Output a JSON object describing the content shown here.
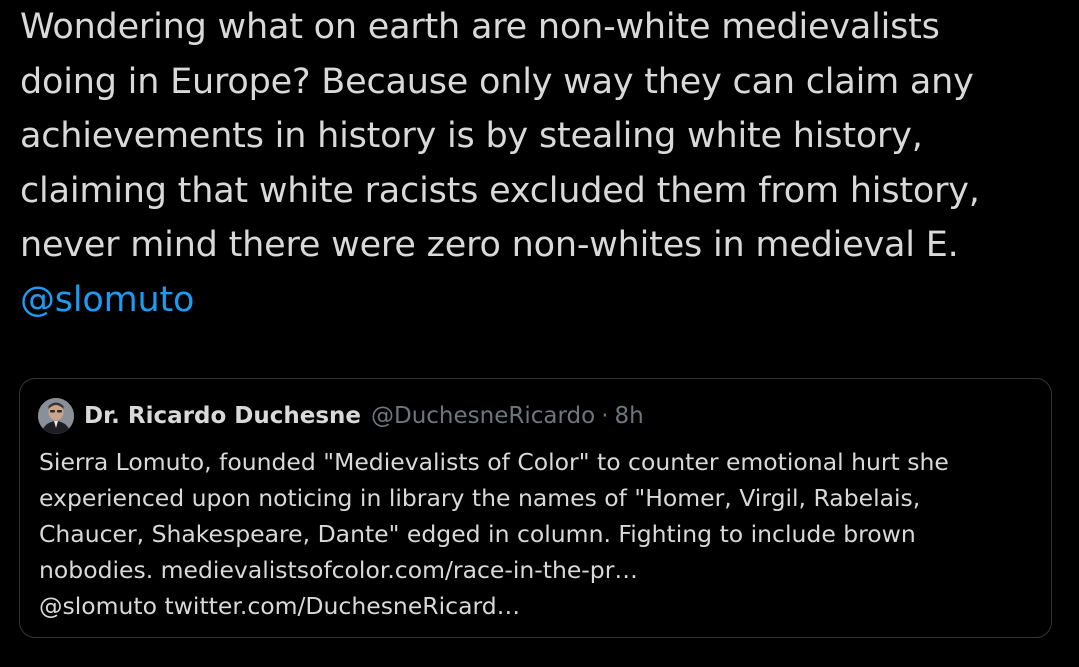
{
  "tweet": {
    "lines": [
      "Wondering what on earth are non-white medievalists",
      "doing in Europe? Because only way they can claim any",
      "achievements in history is by stealing white history,",
      "claiming that white racists excluded them from history,",
      "never mind there were zero non-whites in medieval E."
    ],
    "mention": "@slomuto"
  },
  "quote": {
    "author_name": "Dr. Ricardo Duchesne",
    "author_handle": "@DuchesneRicardo",
    "separator": "·",
    "time": "8h",
    "lines": [
      "Sierra Lomuto, founded \"Medievalists of Color\" to counter emotional hurt she",
      "experienced upon noticing in library the names of \"Homer, Virgil, Rabelais,",
      "Chaucer, Shakespeare, Dante\" edged in column. Fighting to include brown",
      "nobodies. medievalistsofcolor.com/race-in-the-pr…",
      "@slomuto twitter.com/DuchesneRicard…"
    ]
  },
  "colors": {
    "background": "#000000",
    "text": "#d9d9d9",
    "link": "#1d9bf0",
    "muted": "#6e767d",
    "border": "#333639"
  }
}
